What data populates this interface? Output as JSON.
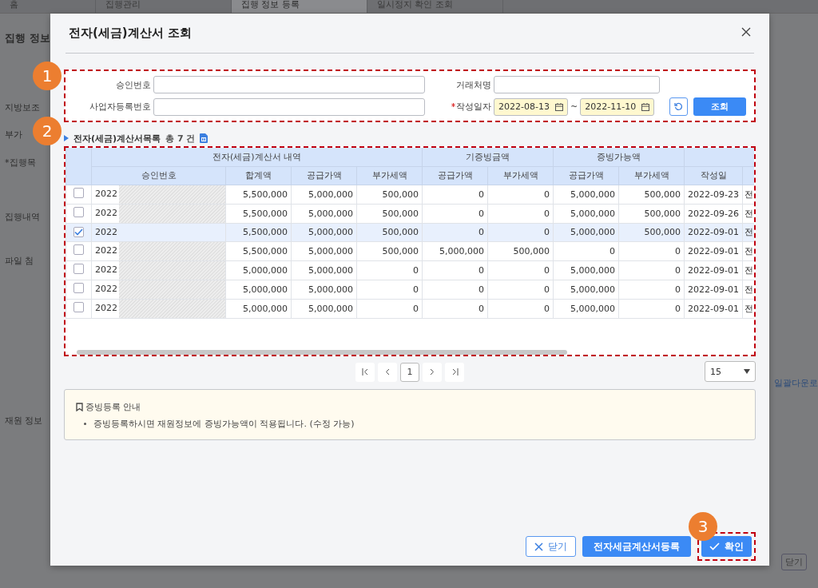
{
  "background": {
    "tabs": [
      {
        "label": "홈",
        "selected": false
      },
      {
        "label": "집행관리",
        "selected": false
      },
      {
        "label": "집행 정보 등록",
        "selected": true
      },
      {
        "label": "일시정지 확인 조회",
        "selected": false
      }
    ],
    "page_title": "집행 정보",
    "left_labels": [
      "지방보조",
      "부가",
      "*집행목",
      "집행내역",
      "파일 첨",
      "재원 정보"
    ],
    "right_link": "일괄다운로",
    "right_button": "닫기"
  },
  "dialog": {
    "title": "전자(세금)계산서 조회",
    "search": {
      "fields": [
        {
          "label": "승인번호",
          "required": false
        },
        {
          "label": "거래처명",
          "required": false
        },
        {
          "label": "사업자등록번호",
          "required": false
        }
      ],
      "date": {
        "label": "작성일자",
        "required": true,
        "from": "2022-08-13",
        "separator": "~",
        "to": "2022-11-10"
      },
      "search_button": "조회"
    },
    "list": {
      "title": "전자(세금)계산서목록",
      "count": "총 7 건",
      "group_headers": [
        "전자(세금)계산서 내역",
        "기증빙금액",
        "증빙가능액"
      ],
      "columns": [
        "승인번호",
        "합계액",
        "공급가액",
        "부가세액",
        "공급가액",
        "부가세액",
        "공급가액",
        "부가세액",
        "작성일"
      ],
      "rows": [
        {
          "selected": false,
          "redacted": true,
          "cells": [
            "2022",
            "5,500,000",
            "5,000,000",
            "500,000",
            "0",
            "0",
            "5,000,000",
            "500,000",
            "2022-09-23",
            "전"
          ]
        },
        {
          "selected": false,
          "redacted": true,
          "cells": [
            "2022",
            "5,500,000",
            "5,000,000",
            "500,000",
            "0",
            "0",
            "5,000,000",
            "500,000",
            "2022-09-26",
            "전"
          ]
        },
        {
          "selected": true,
          "redacted": false,
          "cells": [
            "2022",
            "5,500,000",
            "5,000,000",
            "500,000",
            "0",
            "0",
            "5,000,000",
            "500,000",
            "2022-09-01",
            "전"
          ]
        },
        {
          "selected": false,
          "redacted": true,
          "cells": [
            "2022",
            "5,500,000",
            "5,000,000",
            "500,000",
            "5,000,000",
            "500,000",
            "0",
            "0",
            "2022-09-01",
            "전"
          ]
        },
        {
          "selected": false,
          "redacted": true,
          "cells": [
            "2022",
            "5,000,000",
            "5,000,000",
            "0",
            "0",
            "0",
            "5,000,000",
            "0",
            "2022-09-01",
            "전"
          ]
        },
        {
          "selected": false,
          "redacted": true,
          "cells": [
            "2022",
            "5,000,000",
            "5,000,000",
            "0",
            "0",
            "0",
            "5,000,000",
            "0",
            "2022-09-01",
            "전"
          ]
        },
        {
          "selected": false,
          "redacted": true,
          "cells": [
            "2022",
            "5,000,000",
            "5,000,000",
            "0",
            "0",
            "0",
            "5,000,000",
            "0",
            "2022-09-01",
            "전"
          ]
        }
      ],
      "pagination": {
        "pages": [
          {
            "label": "1",
            "selected": true
          }
        ],
        "page_size": "15"
      }
    },
    "notice": {
      "title": "증빙등록 안내",
      "items": [
        "증빙등록하시면 재원정보에 증빙가능액이 적용됩니다. (수정 가능)"
      ]
    },
    "buttons": [
      {
        "label": "닫기",
        "kind": "close"
      },
      {
        "label": "전자세금계산서등록",
        "kind": "primary"
      },
      {
        "label": "확인",
        "kind": "confirm"
      }
    ]
  },
  "annotations": [
    "1",
    "2",
    "3"
  ]
}
